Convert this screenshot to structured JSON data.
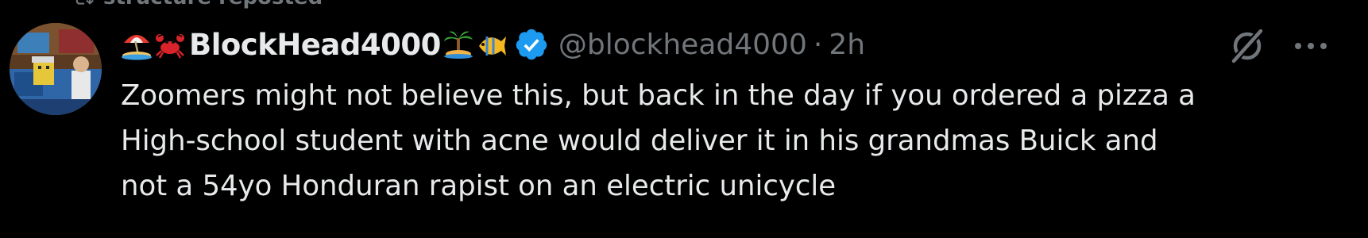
{
  "repost": {
    "label": "structure reposted",
    "icon": "repost-icon"
  },
  "author": {
    "display_name": "BlockHead4000",
    "handle": "@blockhead4000",
    "separator": "·",
    "time": "2h",
    "verified": true,
    "name_emojis_before": [
      "beach-umbrella-emoji",
      "crab-emoji"
    ],
    "name_emojis_after": [
      "desert-island-emoji",
      "tropical-fish-emoji"
    ]
  },
  "actions": {
    "grok_icon": "grok-icon",
    "more_icon": "more-dots-icon"
  },
  "post": {
    "lines": [
      "Zoomers might not believe this, but back in the day if you ordered a pizza a",
      "High-school student with acne would deliver it in his grandmas Buick and",
      "not a 54yo Honduran rapist on an electric unicycle"
    ]
  },
  "colors": {
    "background": "#000000",
    "text": "#e7e9ea",
    "secondary": "#71767b",
    "verified": "#1d9bf0"
  }
}
